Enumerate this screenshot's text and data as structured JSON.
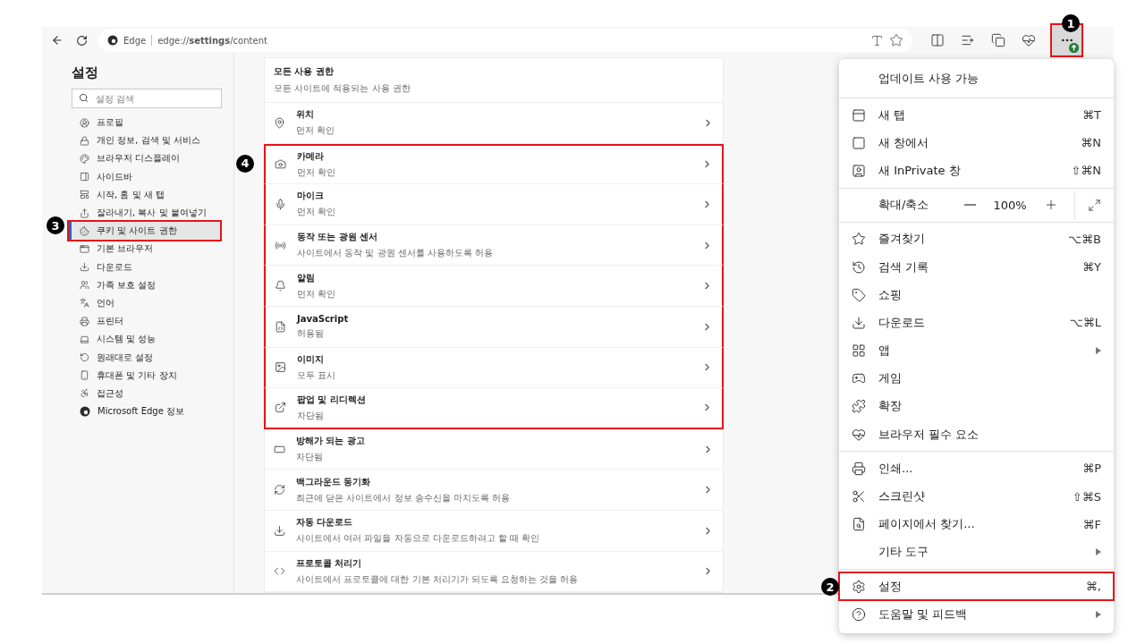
{
  "toolbar": {
    "site": "Edge",
    "url": "edge://**settings**/content",
    "more_annotation": "1"
  },
  "sidebar": {
    "title": "설정",
    "search": {
      "placeholder": "설정 검색"
    },
    "items": [
      {
        "label": "프로필",
        "selected": false
      },
      {
        "label": "개인 정보, 검색 및 서비스",
        "selected": false
      },
      {
        "label": "브라우저 디스플레이",
        "selected": false
      },
      {
        "label": "사이드바",
        "selected": false
      },
      {
        "label": "시작, 홈 및 새 탭",
        "selected": false
      },
      {
        "label": "잘라내기, 복사 및 붙여넣기",
        "selected": false
      },
      {
        "label": "쿠키 및 사이트 권한",
        "selected": true,
        "annotation": "3"
      },
      {
        "label": "기본 브라우저",
        "selected": false
      },
      {
        "label": "다운로드",
        "selected": false
      },
      {
        "label": "가족 보호 설정",
        "selected": false
      },
      {
        "label": "언어",
        "selected": false
      },
      {
        "label": "프린터",
        "selected": false
      },
      {
        "label": "시스템 및 성능",
        "selected": false
      },
      {
        "label": "원래대로 설정",
        "selected": false
      },
      {
        "label": "휴대폰 및 기타 장치",
        "selected": false
      },
      {
        "label": "접근성",
        "selected": false
      },
      {
        "label": "Microsoft Edge 정보",
        "selected": false
      }
    ]
  },
  "content": {
    "section": {
      "title": "모든 사용 권한",
      "subtitle": "모든 사이트에 적용되는 사용 권한"
    },
    "highlight_annotation": "4",
    "rows": [
      {
        "title": "위치",
        "subtitle": "먼저 확인",
        "highlighted": false
      },
      {
        "title": "카메라",
        "subtitle": "먼저 확인",
        "highlighted": true
      },
      {
        "title": "마이크",
        "subtitle": "먼저 확인",
        "highlighted": true
      },
      {
        "title": "동작 또는 광원 센서",
        "subtitle": "사이트에서 동작 및 광원 센서를 사용하도록 허용",
        "highlighted": true
      },
      {
        "title": "알림",
        "subtitle": "먼저 확인",
        "highlighted": true
      },
      {
        "title": "JavaScript",
        "subtitle": "허용됨",
        "highlighted": true
      },
      {
        "title": "이미지",
        "subtitle": "모두 표시",
        "highlighted": true
      },
      {
        "title": "팝업 및 리디렉션",
        "subtitle": "차단됨",
        "highlighted": true
      },
      {
        "title": "방해가 되는 광고",
        "subtitle": "차단됨",
        "highlighted": false
      },
      {
        "title": "백그라운드 동기화",
        "subtitle": "최근에 닫은 사이트에서 정보 송수신을 마치도록 허용",
        "highlighted": false
      },
      {
        "title": "자동 다운로드",
        "subtitle": "사이트에서 여러 파일을 자동으로 다운로드하려고 할 때 확인",
        "highlighted": false
      },
      {
        "title": "프로토콜 처리기",
        "subtitle": "사이트에서 프로토콜에 대한 기본 처리기가 되도록 요청하는 것을 허용",
        "highlighted": false
      }
    ]
  },
  "menu": {
    "items": [
      {
        "kind": "header",
        "label": "업데이트 사용 가능"
      },
      {
        "kind": "divider"
      },
      {
        "kind": "item",
        "label": "새 탭",
        "shortcut": "⌘T",
        "submenu": false
      },
      {
        "kind": "item",
        "label": "새 창에서",
        "shortcut": "⌘N",
        "submenu": false
      },
      {
        "kind": "item",
        "label": "새 InPrivate 창",
        "shortcut": "⇧⌘N",
        "submenu": false
      },
      {
        "kind": "divider"
      },
      {
        "kind": "zoom",
        "label": "확대/축소",
        "value": "100%"
      },
      {
        "kind": "divider"
      },
      {
        "kind": "item",
        "label": "즐겨찾기",
        "shortcut": "⌥⌘B",
        "submenu": false
      },
      {
        "kind": "item",
        "label": "검색 기록",
        "shortcut": "⌘Y",
        "submenu": false
      },
      {
        "kind": "item",
        "label": "쇼핑",
        "submenu": false
      },
      {
        "kind": "item",
        "label": "다운로드",
        "shortcut": "⌥⌘L",
        "submenu": false
      },
      {
        "kind": "item",
        "label": "앱",
        "submenu": true
      },
      {
        "kind": "item",
        "label": "게임",
        "submenu": false
      },
      {
        "kind": "item",
        "label": "확장",
        "submenu": false
      },
      {
        "kind": "item",
        "label": "브라우저 필수 요소",
        "submenu": false
      },
      {
        "kind": "divider"
      },
      {
        "kind": "item",
        "label": "인쇄...",
        "shortcut": "⌘P",
        "submenu": false
      },
      {
        "kind": "item",
        "label": "스크린샷",
        "shortcut": "⇧⌘S",
        "submenu": false
      },
      {
        "kind": "item",
        "label": "페이지에서 찾기...",
        "shortcut": "⌘F",
        "submenu": false
      },
      {
        "kind": "item",
        "label": "기타 도구",
        "submenu": true
      },
      {
        "kind": "divider"
      },
      {
        "kind": "item",
        "label": "설정",
        "shortcut": "⌘,",
        "submenu": false,
        "annotation": "2"
      },
      {
        "kind": "item",
        "label": "도움말 및 피드백",
        "submenu": true
      }
    ]
  }
}
